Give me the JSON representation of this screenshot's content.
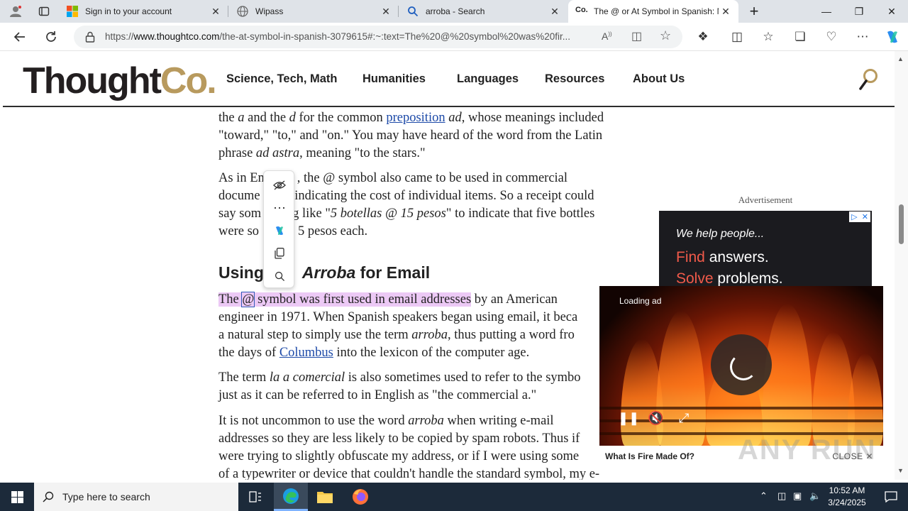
{
  "browser": {
    "tabs": [
      {
        "title": "",
        "icon": "profile-icon"
      },
      {
        "title": "",
        "icon": "tab-actions-icon"
      },
      {
        "title": "Sign in to your account",
        "icon": "microsoft-icon"
      },
      {
        "title": "Wipass",
        "icon": "globe-icon"
      },
      {
        "title": "arroba - Search",
        "icon": "search-icon"
      },
      {
        "title": "The @ or At Symbol in Spanish: N",
        "icon": "thoughtco-icon",
        "active": true
      }
    ],
    "url_domain": "www.thoughtco.com",
    "url_prefix": "https://",
    "url_path": "/the-at-symbol-in-spanish-3079615#:~:text=The%20@%20symbol%20was%20fir..."
  },
  "site": {
    "logo_main": "Thought",
    "logo_accent": "Co.",
    "nav": [
      "Science, Tech, Math",
      "Humanities",
      "Languages",
      "Resources",
      "About Us"
    ]
  },
  "article": {
    "p1_a": "the ",
    "p1_b": "a",
    "p1_c": " and the ",
    "p1_d": "d",
    "p1_e": " for the common ",
    "p1_link": "preposition",
    "p1_f": " ",
    "p1_g": "ad",
    "p1_h": ", whose meanings included \"toward,\" \"to,\" and \"on.\" You may have heard of the word from the Latin phrase ",
    "p1_i": "ad astra",
    "p1_j": ", meaning \"to the stars.\"",
    "p2_line1": "As in En",
    "p2_line1b": ", the @ symbol also came to be used in commercial",
    "p2_line2": "docume",
    "p2_line2b": " indicating the cost of individual items. So a receipt could",
    "p2_line3": "say som",
    "p2_line3b": "g like \"",
    "p2_line3c": "5 botellas @ 15 pesos",
    "p2_line3d": "\" to indicate that five bottles",
    "p2_line4": "were so",
    "p2_line4b": "5 pesos each.",
    "h2_a": "Using",
    "h2_b": "Arroba",
    "h2_c": " for Email",
    "p3_hl1": "The ",
    "p3_sel": "@",
    "p3_hl2": " symbol was first used in email addresses",
    "p3_rest1": " by an American",
    "p3_line2": "engineer in 1971. When Spanish speakers began using email, it beca",
    "p3_line3a": "a natural step to simply use the term ",
    "p3_line3b": "arroba",
    "p3_line3c": ", thus putting a word fro",
    "p3_line4a": "the days of ",
    "p3_link": "Columbus",
    "p3_line4b": " into the lexicon of the computer age.",
    "p4_a": "The term ",
    "p4_b": "la a comercial",
    "p4_c": " is also sometimes used to refer to the symbo",
    "p4_line2": "just as it can be referred to in English as \"the commercial a.\"",
    "p5_a": "It is not uncommon to use the word ",
    "p5_b": "arroba",
    "p5_c": " when writing e-mail",
    "p5_line2": "addresses so they are less likely to be copied by spam robots. Thus if",
    "p5_line3": "were trying to slightly obfuscate my address, or if I were using some",
    "p5_line4": "of a typewriter or device that couldn't handle the standard symbol, my e-"
  },
  "ad": {
    "label": "Advertisement",
    "line1": "We help people...",
    "line2_accent": "Find",
    "line2_rest": " answers.",
    "line3_accent": "Solve",
    "line3_rest": " problems."
  },
  "video": {
    "status": "Loading ad",
    "title": "What Is Fire Made Of?",
    "close": "CLOSE"
  },
  "watermark": "ANY RUN",
  "taskbar": {
    "search_placeholder": "Type here to search",
    "time": "10:52 AM",
    "date": "3/24/2025"
  }
}
